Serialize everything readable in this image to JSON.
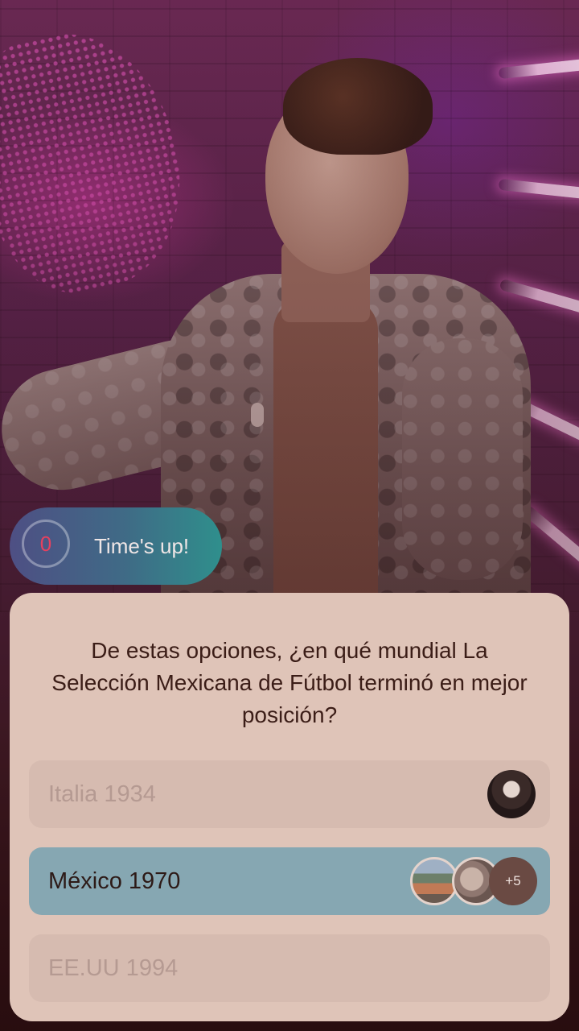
{
  "timer": {
    "seconds_left": "0",
    "status_text": "Time's up!"
  },
  "question": {
    "text": "De estas opciones, ¿en qué mundial La Selección Mexicana de Fútbol terminó en mejor posición?",
    "options": [
      {
        "label": "Italia 1934",
        "state": "dimmed",
        "voter_avatars": 1,
        "more_count": ""
      },
      {
        "label": "México 1970",
        "state": "highlighted",
        "voter_avatars": 2,
        "more_count": "+5"
      },
      {
        "label": "EE.UU 1994",
        "state": "dimmed",
        "voter_avatars": 0,
        "more_count": ""
      }
    ]
  },
  "colors": {
    "timer_number": "#e5415f",
    "card_bg": "#dfc4b8",
    "selected_option_bg": "#86a7b2",
    "dim_option_bg": "#d6bbb0"
  }
}
